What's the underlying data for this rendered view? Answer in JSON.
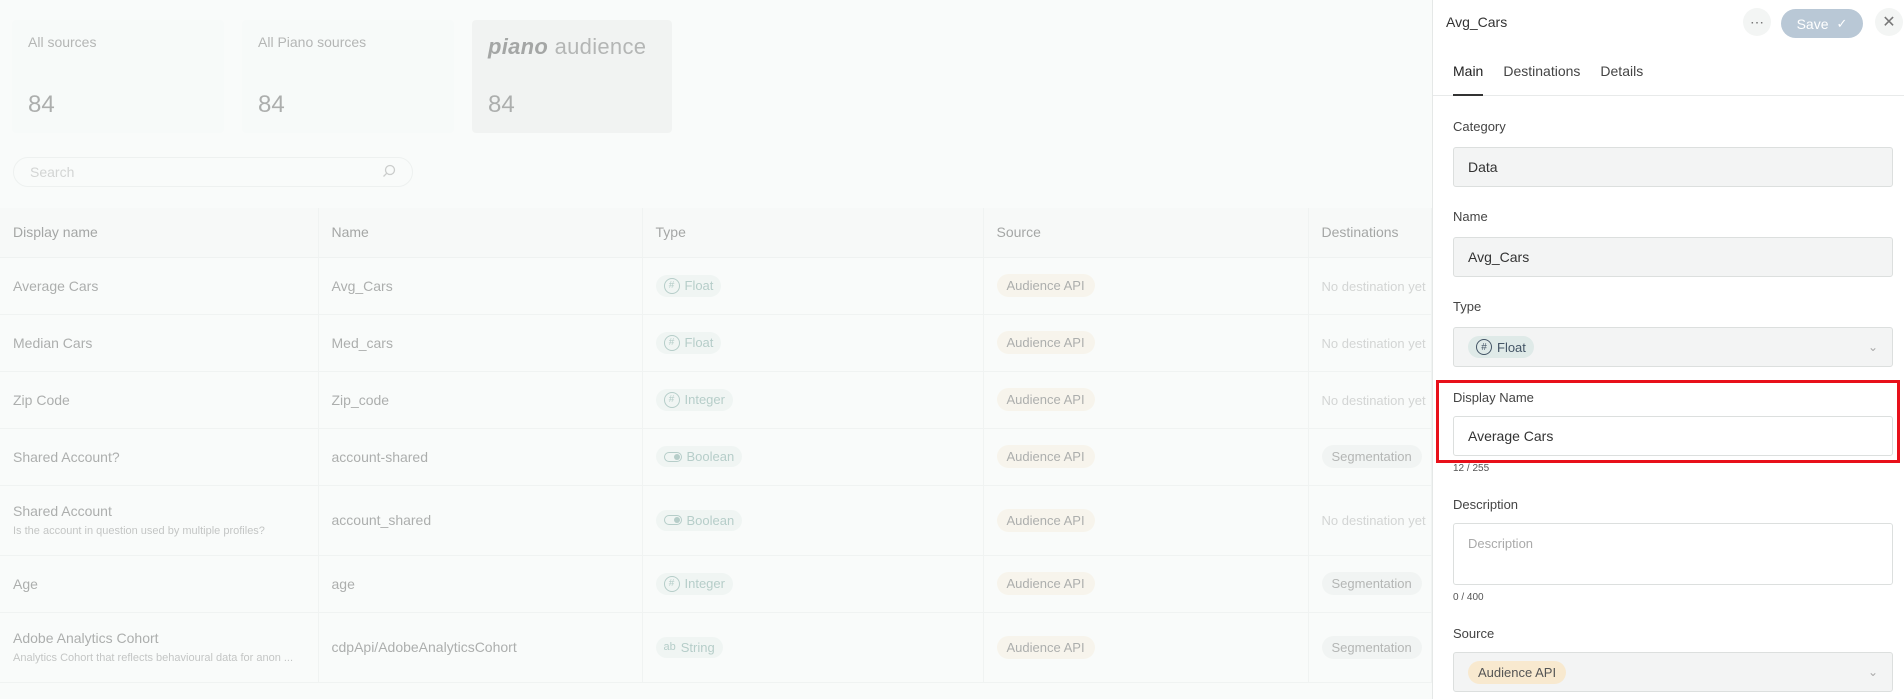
{
  "cards": [
    {
      "label": "All sources",
      "count": "84"
    },
    {
      "label": "All Piano sources",
      "count": "84"
    },
    {
      "logo_bold": "piano",
      "logo_rest": " audience",
      "count": "84"
    }
  ],
  "search": {
    "placeholder": "Search"
  },
  "table": {
    "headers": [
      "Display name",
      "Name",
      "Type",
      "Source",
      "Destinations"
    ],
    "rows": [
      {
        "display": "Average Cars",
        "sub": "",
        "name": "Avg_Cars",
        "type": "Float",
        "type_icon": "hash-icon",
        "source": "Audience API",
        "dest": "No destination yet"
      },
      {
        "display": "Median Cars",
        "sub": "",
        "name": "Med_cars",
        "type": "Float",
        "type_icon": "hash-icon",
        "source": "Audience API",
        "dest": "No destination yet"
      },
      {
        "display": "Zip Code",
        "sub": "",
        "name": "Zip_code",
        "type": "Integer",
        "type_icon": "hash-icon",
        "source": "Audience API",
        "dest": "No destination yet"
      },
      {
        "display": "Shared Account?",
        "sub": "",
        "name": "account-shared",
        "type": "Boolean",
        "type_icon": "toggle-icon",
        "source": "Audience API",
        "dest_tag": "Segmentation"
      },
      {
        "display": "Shared Account",
        "sub": "Is the account in question used by multiple profiles?",
        "name": "account_shared",
        "type": "Boolean",
        "type_icon": "toggle-icon",
        "source": "Audience API",
        "dest": "No destination yet"
      },
      {
        "display": "Age",
        "sub": "",
        "name": "age",
        "type": "Integer",
        "type_icon": "hash-icon",
        "source": "Audience API",
        "dest_tag": "Segmentation"
      },
      {
        "display": "Adobe Analytics Cohort",
        "sub": "Analytics Cohort that reflects behavioural data for anon ...",
        "name": "cdpApi/AdobeAnalyticsCohort",
        "type": "String",
        "type_icon": "string-icon",
        "source": "Audience API",
        "dest_tag": "Segmentation"
      }
    ]
  },
  "panel": {
    "title": "Avg_Cars",
    "save_label": "Save",
    "tabs": [
      "Main",
      "Destinations",
      "Details"
    ],
    "category": {
      "label": "Category",
      "value": "Data"
    },
    "name": {
      "label": "Name",
      "value": "Avg_Cars"
    },
    "type": {
      "label": "Type",
      "value": "Float"
    },
    "display_name": {
      "label": "Display Name",
      "value": "Average Cars",
      "counter": "12 / 255"
    },
    "description": {
      "label": "Description",
      "placeholder": "Description",
      "counter": "0 / 400"
    },
    "source": {
      "label": "Source",
      "value": "Audience API"
    }
  }
}
